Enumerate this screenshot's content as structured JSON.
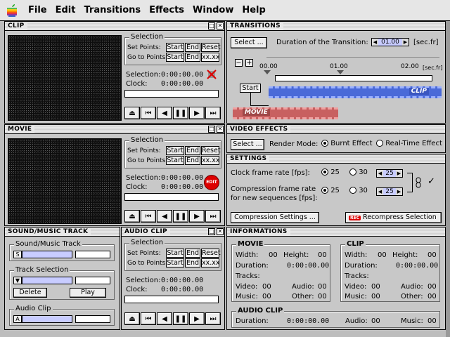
{
  "menu": {
    "items": [
      "File",
      "Edit",
      "Transitions",
      "Effects",
      "Window",
      "Help"
    ]
  },
  "clip": {
    "title": "CLIP",
    "selection_heading": "Selection",
    "set_points": "Set Points:",
    "go_to_points": "Go to Points:",
    "start": "Start",
    "end": "End",
    "reset": "Reset",
    "xx": "xx.xx",
    "selection_label": "Selection:",
    "selection_value": "0:00:00.00",
    "clock_label": "Clock:",
    "clock_value": "0:00:00.00"
  },
  "movie": {
    "title": "MOVIE",
    "selection_heading": "Selection",
    "set_points": "Set Points:",
    "go_to_points": "Go to Points:",
    "start": "Start",
    "end": "End",
    "reset": "Reset",
    "xx": "xx.xx",
    "selection_label": "Selection:",
    "selection_value": "0:00:00.00",
    "clock_label": "Clock:",
    "clock_value": "0:00:00.00",
    "edit_badge": "EDIT"
  },
  "transitions": {
    "title": "TRANSITIONS",
    "select_label": "Select ...",
    "duration_label": "Duration of the Transition:",
    "duration_value": "01.00",
    "unit": "[sec.fr]",
    "ruler": [
      "00.00",
      "01.00",
      "02.00"
    ],
    "ruler_unit": "[sec.fr]",
    "start_label": "Start",
    "clip_label": "CLIP",
    "movie_label": "MOVIE"
  },
  "video_effects": {
    "title": "VIDEO EFFECTS",
    "select_label": "Select ...",
    "render_mode_label": "Render Mode:",
    "burnt": "Burnt Effect",
    "realtime": "Real-Time Effect"
  },
  "settings": {
    "title": "SETTINGS",
    "clock_rate_label": "Clock frame rate [fps]:",
    "compression_label_1": "Compression frame rate",
    "compression_label_2": "for new sequences [fps]:",
    "opt25": "25",
    "opt30": "30",
    "clock_value": "25",
    "compression_value": "25",
    "compression_settings": "Compression Settings ...",
    "recompress": "Recompress Selection",
    "rec_badge": "REC"
  },
  "sound": {
    "title": "SOUND/MUSIC TRACK",
    "group_track": "Sound/Music Track",
    "track_letter": "S",
    "group_selection": "Track Selection",
    "delete": "Delete",
    "play": "Play",
    "group_audio": "Audio Clip",
    "audio_letter": "A"
  },
  "audio_clip": {
    "title": "AUDIO CLIP",
    "selection_heading": "Selection",
    "set_points": "Set Points:",
    "go_to_points": "Go to Points:",
    "start": "Start",
    "end": "End",
    "reset": "Reset",
    "xx": "xx.xx",
    "selection_label": "Selection:",
    "selection_value": "0:00:00.00",
    "clock_label": "Clock:",
    "clock_value": "0:00:00.00"
  },
  "informations": {
    "title": "INFORMATIONS",
    "movie": {
      "heading": "MOVIE",
      "width_label": "Width:",
      "width": "00",
      "height_label": "Height:",
      "height": "00",
      "duration_label": "Duration:",
      "duration": "0:00:00.00",
      "tracks_label": "Tracks:",
      "video_label": "Video:",
      "video": "00",
      "audio_label": "Audio:",
      "audio": "00",
      "music_label": "Music:",
      "music": "00",
      "other_label": "Other:",
      "other": "00"
    },
    "clip": {
      "heading": "CLIP",
      "width_label": "Width:",
      "width": "00",
      "height_label": "Height:",
      "height": "00",
      "duration_label": "Duration:",
      "duration": "0:00:00.00",
      "tracks_label": "Tracks:",
      "video_label": "Video:",
      "video": "00",
      "audio_label": "Audio:",
      "audio": "00",
      "music_label": "Music:",
      "music": "00",
      "other_label": "Other:",
      "other": "00"
    },
    "audio_clip": {
      "heading": "AUDIO CLIP",
      "duration_label": "Duration:",
      "duration": "0:00:00.00",
      "audio_label": "Audio:",
      "audio": "00",
      "music_label": "Music:",
      "music": "00"
    }
  }
}
